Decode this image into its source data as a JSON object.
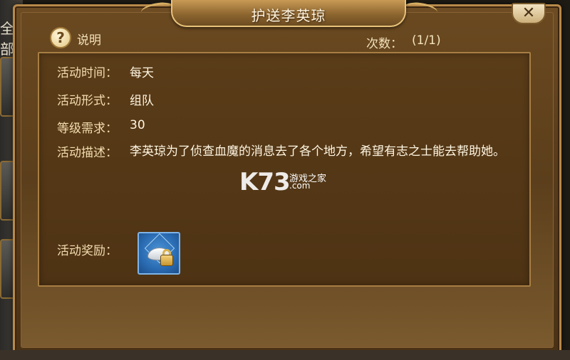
{
  "background": {
    "tab_label": "全部"
  },
  "dialog": {
    "title": "护送李英琼",
    "close_label": "✕",
    "help_icon_glyph": "?",
    "help_label": "说明",
    "count_label": "次数：",
    "count_value": "(1/1)"
  },
  "details": {
    "rows": [
      {
        "label": "活动时间：",
        "value": "每天"
      },
      {
        "label": "活动形式：",
        "value": "组队"
      },
      {
        "label": "等级需求：",
        "value": "30"
      },
      {
        "label": "活动描述：",
        "value": "李英琼为了侦查血魔的消息去了各个地方，希望有志之士能去帮助她。"
      }
    ],
    "reward_label": "活动奖励：",
    "reward_item": {
      "icon": "locked-silver-ingot-icon"
    }
  },
  "watermark": {
    "main": "K73",
    "sub": "游戏之家",
    "domain": ".com"
  },
  "colors": {
    "frame_gold": "#b8894a",
    "panel_brown": "#5a3c18",
    "text_cream": "#f4ddb0",
    "reward_blue": "#2a6bb2"
  }
}
